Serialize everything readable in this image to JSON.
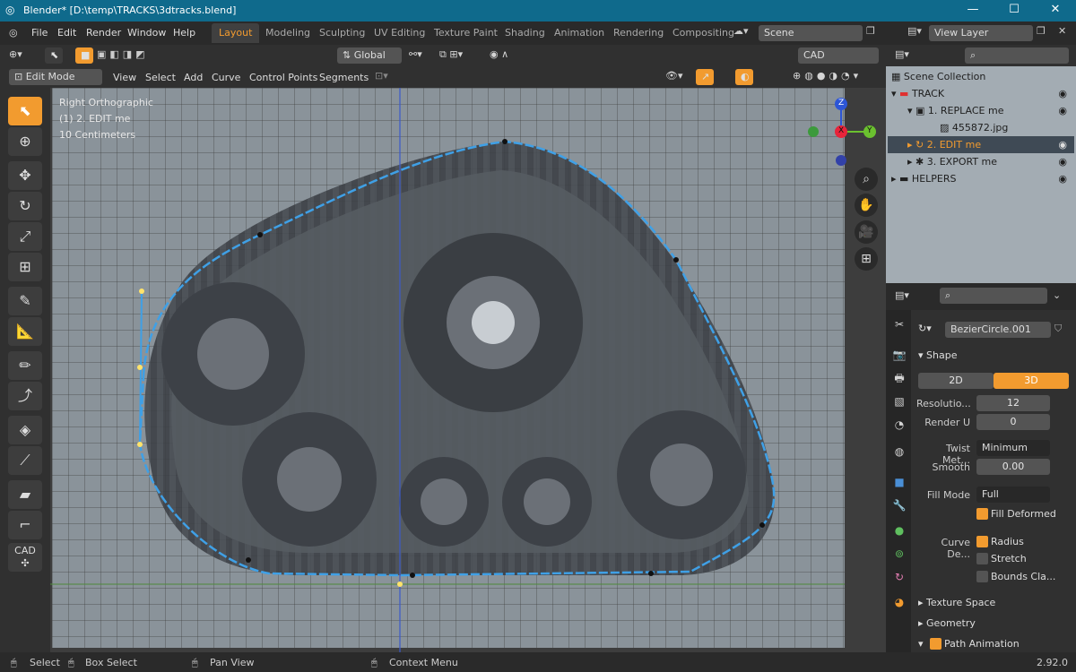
{
  "titlebar": {
    "title": "Blender* [D:\\temp\\TRACKS\\3dtracks.blend]",
    "min": "—",
    "max": "☐",
    "close": "✕"
  },
  "menubar": {
    "items": [
      "File",
      "Edit",
      "Render",
      "Window",
      "Help"
    ],
    "workspaces": [
      "Layout",
      "Modeling",
      "Sculpting",
      "UV Editing",
      "Texture Paint",
      "Shading",
      "Animation",
      "Rendering",
      "Compositing"
    ],
    "scene": "Scene",
    "view_layer": "View Layer"
  },
  "header": {
    "orientation": "Global",
    "cad_transform": "CAD Transform",
    "mode": "Edit Mode",
    "menus": [
      "View",
      "Select",
      "Add",
      "Curve",
      "Control Points",
      "Segments"
    ]
  },
  "viewport": {
    "view_name": "Right Orthographic",
    "object_info": "(1) 2. EDIT me",
    "scale": "10 Centimeters",
    "axis_x": "X",
    "axis_y": "Y",
    "axis_z": "Z"
  },
  "toolbar": {
    "cad_label": "CAD"
  },
  "outliner": {
    "root": "Scene Collection",
    "rows": [
      {
        "label": "TRACK",
        "selected": false
      },
      {
        "label": "1. REPLACE me",
        "selected": false
      },
      {
        "label": "455872.jpg",
        "selected": false
      },
      {
        "label": "2. EDIT me",
        "selected": true
      },
      {
        "label": "3. EXPORT me",
        "selected": false
      },
      {
        "label": "HELPERS",
        "selected": false
      }
    ]
  },
  "properties": {
    "object_name": "BezierCircle.001",
    "shape_section": "Shape",
    "dim_2d": "2D",
    "dim_3d": "3D",
    "resolution_label": "Resolutio...",
    "resolution_value": "12",
    "render_u_label": "Render U",
    "render_u_value": "0",
    "twist_label": "Twist Met...",
    "twist_value": "Minimum",
    "smooth_label": "Smooth",
    "smooth_value": "0.00",
    "fill_mode_label": "Fill Mode",
    "fill_mode_value": "Full",
    "fill_deformed": "Fill Deformed",
    "curve_deform_label": "Curve De...",
    "radius": "Radius",
    "stretch": "Stretch",
    "bounds_clamp": "Bounds Cla...",
    "texture_space": "Texture Space",
    "geometry": "Geometry",
    "path_animation": "Path Animation"
  },
  "statusbar": {
    "select": "Select",
    "box_select": "Box Select",
    "pan_view": "Pan View",
    "context_menu": "Context Menu",
    "version": "2.92.0"
  },
  "colors": {
    "accent": "#f29b2f",
    "curve": "#3fa0e6",
    "titlebar": "#0f6a8c"
  }
}
